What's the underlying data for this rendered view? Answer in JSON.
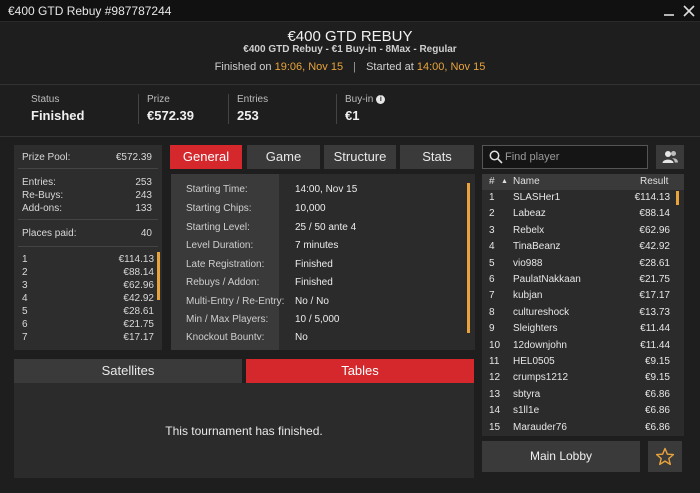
{
  "window": {
    "title": "€400 GTD Rebuy #987787244"
  },
  "header": {
    "title": "€400 GTD REBUY",
    "subtitle": "€400 GTD Rebuy - €1 Buy-in - 8Max - Regular",
    "finished_label": "Finished on",
    "finished_value": "19:06, Nov 15",
    "started_label": "Started at",
    "started_value": "14:00, Nov 15",
    "separator": "|"
  },
  "stats": [
    {
      "label": "Status",
      "value": "Finished"
    },
    {
      "label": "Prize",
      "value": "€572.39"
    },
    {
      "label": "Entries",
      "value": "253"
    },
    {
      "label": "Buy-in",
      "value": "€1"
    }
  ],
  "summary": {
    "prize_pool_label": "Prize Pool:",
    "prize_pool_value": "€572.39",
    "entries_label": "Entries:",
    "entries_value": "253",
    "rebuys_label": "Re-Buys:",
    "rebuys_value": "243",
    "addons_label": "Add-ons:",
    "addons_value": "133",
    "places_label": "Places paid:",
    "places_value": "40",
    "payouts": [
      {
        "place": "1",
        "amount": "€114.13"
      },
      {
        "place": "2",
        "amount": "€88.14"
      },
      {
        "place": "3",
        "amount": "€62.96"
      },
      {
        "place": "4",
        "amount": "€42.92"
      },
      {
        "place": "5",
        "amount": "€28.61"
      },
      {
        "place": "6",
        "amount": "€21.75"
      },
      {
        "place": "7",
        "amount": "€17.17"
      }
    ]
  },
  "tabs": [
    {
      "label": "General",
      "active": true
    },
    {
      "label": "Game",
      "active": false
    },
    {
      "label": "Structure",
      "active": false
    },
    {
      "label": "Stats",
      "active": false
    }
  ],
  "general_info": [
    {
      "label": "Starting Time:",
      "value": "14:00, Nov 15"
    },
    {
      "label": "Starting Chips:",
      "value": "10,000"
    },
    {
      "label": "Starting Level:",
      "value": "25 / 50 ante 4"
    },
    {
      "label": "Level Duration:",
      "value": "7 minutes"
    },
    {
      "label": "Late Registration:",
      "value": "Finished"
    },
    {
      "label": "Rebuys / Addon:",
      "value": "Finished"
    },
    {
      "label": "Multi-Entry / Re-Entry:",
      "value": "No / No"
    },
    {
      "label": "Min / Max Players:",
      "value": "10 / 5,000"
    },
    {
      "label": "Knockout Bounty:",
      "value": "No"
    }
  ],
  "bottom_tabs": [
    {
      "label": "Satellites",
      "active": false
    },
    {
      "label": "Tables",
      "active": true
    }
  ],
  "finished_message": "This tournament has finished.",
  "search": {
    "placeholder": "Find player"
  },
  "results": {
    "headers": {
      "rank": "#",
      "sort": "▲",
      "name": "Name",
      "result": "Result"
    },
    "rows": [
      {
        "rank": "1",
        "name": "SLASHer1",
        "result": "€114.13"
      },
      {
        "rank": "2",
        "name": "Labeaz",
        "result": "€88.14"
      },
      {
        "rank": "3",
        "name": "Rebelx",
        "result": "€62.96"
      },
      {
        "rank": "4",
        "name": "TinaBeanz",
        "result": "€42.92"
      },
      {
        "rank": "5",
        "name": "vio988",
        "result": "€28.61"
      },
      {
        "rank": "6",
        "name": "PaulatNakkaan",
        "result": "€21.75"
      },
      {
        "rank": "7",
        "name": "kubjan",
        "result": "€17.17"
      },
      {
        "rank": "8",
        "name": "cultureshock",
        "result": "€13.73"
      },
      {
        "rank": "9",
        "name": "Sleighters",
        "result": "€11.44"
      },
      {
        "rank": "10",
        "name": "12downjohn",
        "result": "€11.44"
      },
      {
        "rank": "11",
        "name": "HEL0505",
        "result": "€9.15"
      },
      {
        "rank": "12",
        "name": "crumps1212",
        "result": "€9.15"
      },
      {
        "rank": "13",
        "name": "sbtyra",
        "result": "€6.86"
      },
      {
        "rank": "14",
        "name": "s1ll1e",
        "result": "€6.86"
      },
      {
        "rank": "15",
        "name": "Marauder76",
        "result": "€6.86"
      }
    ]
  },
  "main_lobby_label": "Main Lobby",
  "colors": {
    "accent_red": "#d4282c",
    "accent_orange": "#e8a33c",
    "background": "#1e1e1e"
  }
}
